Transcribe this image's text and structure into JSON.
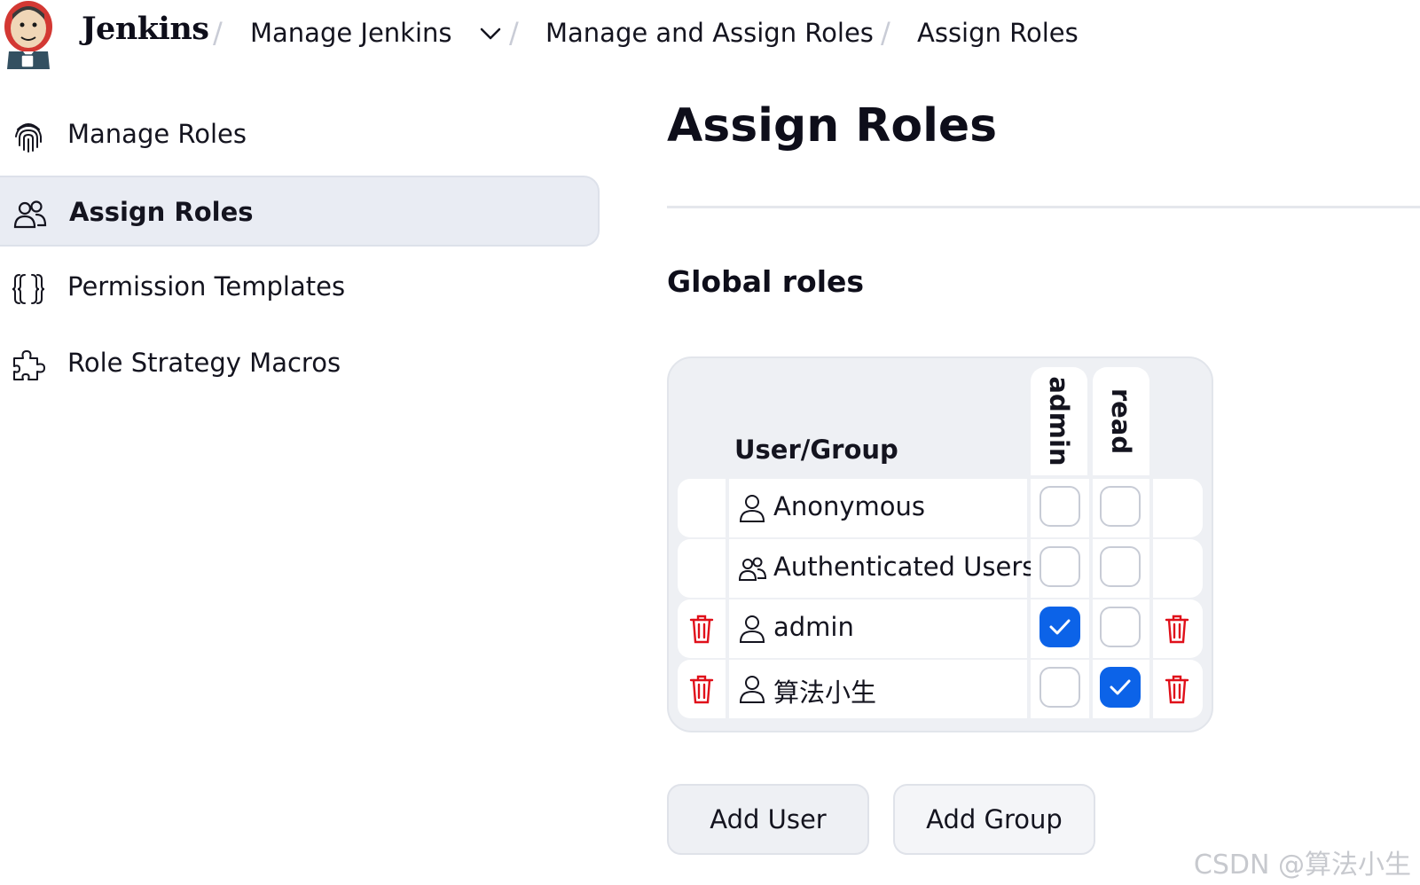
{
  "header": {
    "brand": "Jenkins",
    "breadcrumbs": [
      "Manage Jenkins",
      "Manage and Assign Roles",
      "Assign Roles"
    ],
    "separator": "/"
  },
  "sidebar": {
    "items": [
      {
        "label": "Manage Roles",
        "icon": "fingerprint-icon",
        "active": false
      },
      {
        "label": "Assign Roles",
        "icon": "users-icon",
        "active": true
      },
      {
        "label": "Permission Templates",
        "icon": "braces-icon",
        "active": false
      },
      {
        "label": "Role Strategy Macros",
        "icon": "puzzle-icon",
        "active": false
      }
    ]
  },
  "main": {
    "title": "Assign Roles",
    "section_title": "Global roles",
    "table": {
      "user_group_header": "User/Group",
      "role_columns": [
        "admin",
        "read"
      ],
      "rows": [
        {
          "name": "Anonymous",
          "type": "user",
          "admin": false,
          "read": false,
          "deletable": false
        },
        {
          "name": "Authenticated Users",
          "type": "group",
          "admin": false,
          "read": false,
          "deletable": false
        },
        {
          "name": "admin",
          "type": "user",
          "admin": true,
          "read": false,
          "deletable": true
        },
        {
          "name": "算法小生",
          "type": "user",
          "admin": false,
          "read": true,
          "deletable": true
        }
      ]
    },
    "buttons": {
      "add_user": "Add User",
      "add_group": "Add Group"
    }
  },
  "watermark": "CSDN @算法小生",
  "colors": {
    "accent": "#0c63e8",
    "danger": "#e0101a",
    "active_bg": "#e9ecf3"
  }
}
